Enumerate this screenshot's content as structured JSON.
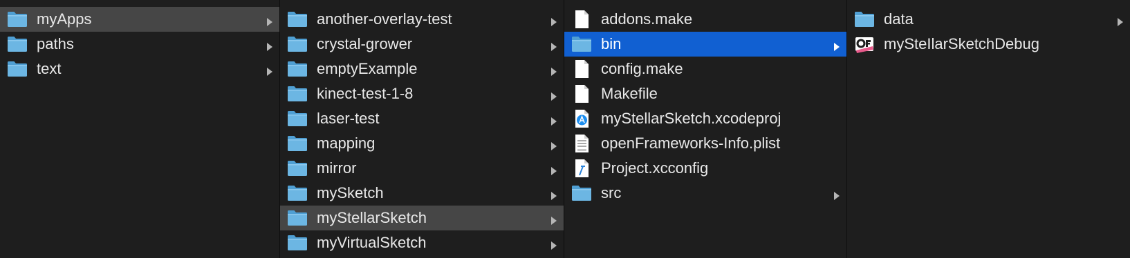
{
  "columns": [
    {
      "items": [
        {
          "label": "myApps",
          "icon": "folder-icon",
          "chevron": true,
          "state": "grey"
        },
        {
          "label": "paths",
          "icon": "folder-icon",
          "chevron": true
        },
        {
          "label": "text",
          "icon": "folder-icon",
          "chevron": true
        }
      ]
    },
    {
      "items": [
        {
          "label": "another-overlay-test",
          "icon": "folder-icon",
          "chevron": true
        },
        {
          "label": "crystal-grower",
          "icon": "folder-icon",
          "chevron": true
        },
        {
          "label": "emptyExample",
          "icon": "folder-icon",
          "chevron": true
        },
        {
          "label": "kinect-test-1-8",
          "icon": "folder-icon",
          "chevron": true
        },
        {
          "label": "laser-test",
          "icon": "folder-icon",
          "chevron": true
        },
        {
          "label": "mapping",
          "icon": "folder-icon",
          "chevron": true
        },
        {
          "label": "mirror",
          "icon": "folder-icon",
          "chevron": true
        },
        {
          "label": "mySketch",
          "icon": "folder-icon",
          "chevron": true
        },
        {
          "label": "myStellarSketch",
          "icon": "folder-icon",
          "chevron": true,
          "state": "grey"
        },
        {
          "label": "myVirtualSketch",
          "icon": "folder-icon",
          "chevron": true
        }
      ]
    },
    {
      "items": [
        {
          "label": "addons.make",
          "icon": "document-icon",
          "chevron": false
        },
        {
          "label": "bin",
          "icon": "folder-icon",
          "chevron": true,
          "state": "blue"
        },
        {
          "label": "config.make",
          "icon": "document-icon",
          "chevron": false
        },
        {
          "label": "Makefile",
          "icon": "document-icon",
          "chevron": false
        },
        {
          "label": "myStellarSketch.xcodeproj",
          "icon": "xcodeproj-icon",
          "chevron": false
        },
        {
          "label": "openFrameworks-Info.plist",
          "icon": "plist-icon",
          "chevron": false
        },
        {
          "label": "Project.xcconfig",
          "icon": "xcconfig-icon",
          "chevron": false
        },
        {
          "label": "src",
          "icon": "folder-icon",
          "chevron": true
        }
      ]
    },
    {
      "items": [
        {
          "label": "data",
          "icon": "folder-icon",
          "chevron": true
        },
        {
          "label": "mySteIlarSketchDebug",
          "icon": "of-app-icon",
          "chevron": false
        }
      ]
    }
  ],
  "colors": {
    "background": "#1e1e1e",
    "selection_inactive": "#464646",
    "selection_active": "#1160d2",
    "folder": "#6cb6e3",
    "chevron": "#b5b5b5"
  }
}
